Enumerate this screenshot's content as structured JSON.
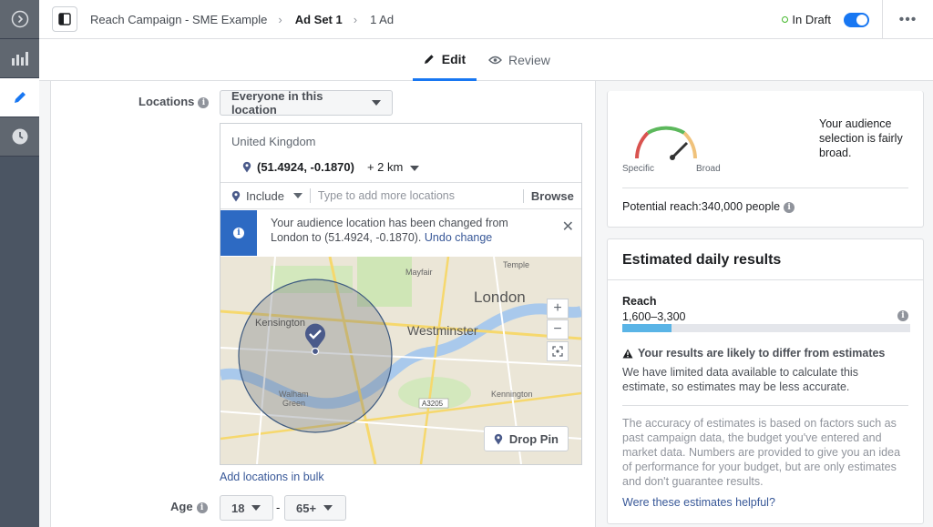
{
  "breadcrumb": {
    "campaign": "Reach Campaign - SME Example",
    "ad_set": "Ad Set 1",
    "ad": "1 Ad"
  },
  "status": {
    "label": "In Draft",
    "enabled": true
  },
  "tabs": {
    "edit": "Edit",
    "review": "Review"
  },
  "locations": {
    "label": "Locations",
    "audience_type": "Everyone in this location",
    "country": "United Kingdom",
    "pin_coords": "(51.4924, -0.1870)",
    "radius": "+ 2 km",
    "include_label": "Include",
    "search_placeholder": "Type to add more locations",
    "browse_label": "Browse",
    "notice_text": "Your audience location has been changed from London to (51.4924, -0.1870).",
    "undo_label": "Undo change",
    "drop_pin_label": "Drop Pin",
    "bulk_link": "Add locations in bulk",
    "map_labels": {
      "london": "London",
      "westminster": "Westminster",
      "kensington": "Kensington",
      "mayfair": "Mayfair",
      "temple": "Temple",
      "walham": "Walham",
      "green": "Green",
      "kennington": "Kennington",
      "road": "A3205"
    }
  },
  "age": {
    "label": "Age",
    "min": "18",
    "max": "65+",
    "separator": "-"
  },
  "audience": {
    "description": "Your audience selection is fairly broad.",
    "specific_label": "Specific",
    "broad_label": "Broad",
    "potential_reach": "Potential reach:340,000 people"
  },
  "estimates": {
    "title": "Estimated daily results",
    "reach_label": "Reach",
    "reach_value": "1,600–3,300",
    "reach_fill": 0.17,
    "warning_title": "Your results are likely to differ from estimates",
    "warning_text": "We have limited data available to calculate this estimate, so estimates may be less accurate.",
    "accuracy_text": "The accuracy of estimates is based on factors such as past campaign data, the budget you've entered and market data. Numbers are provided to give you an idea of performance for your budget, but are only estimates and don't guarantee results.",
    "helpful_link": "Were these estimates helpful?"
  },
  "colors": {
    "accent": "#1877f2",
    "notice": "#2d6ac3",
    "draft": "#42b72a",
    "bar": "#5ab4e6"
  },
  "icons": [
    "chevron-right-circle-icon",
    "bar-chart-icon",
    "pencil-icon",
    "clock-icon",
    "panel-toggle-icon",
    "more-icon",
    "eye-icon",
    "pin-icon",
    "info-icon",
    "close-icon",
    "warning-icon",
    "recenter-icon"
  ]
}
